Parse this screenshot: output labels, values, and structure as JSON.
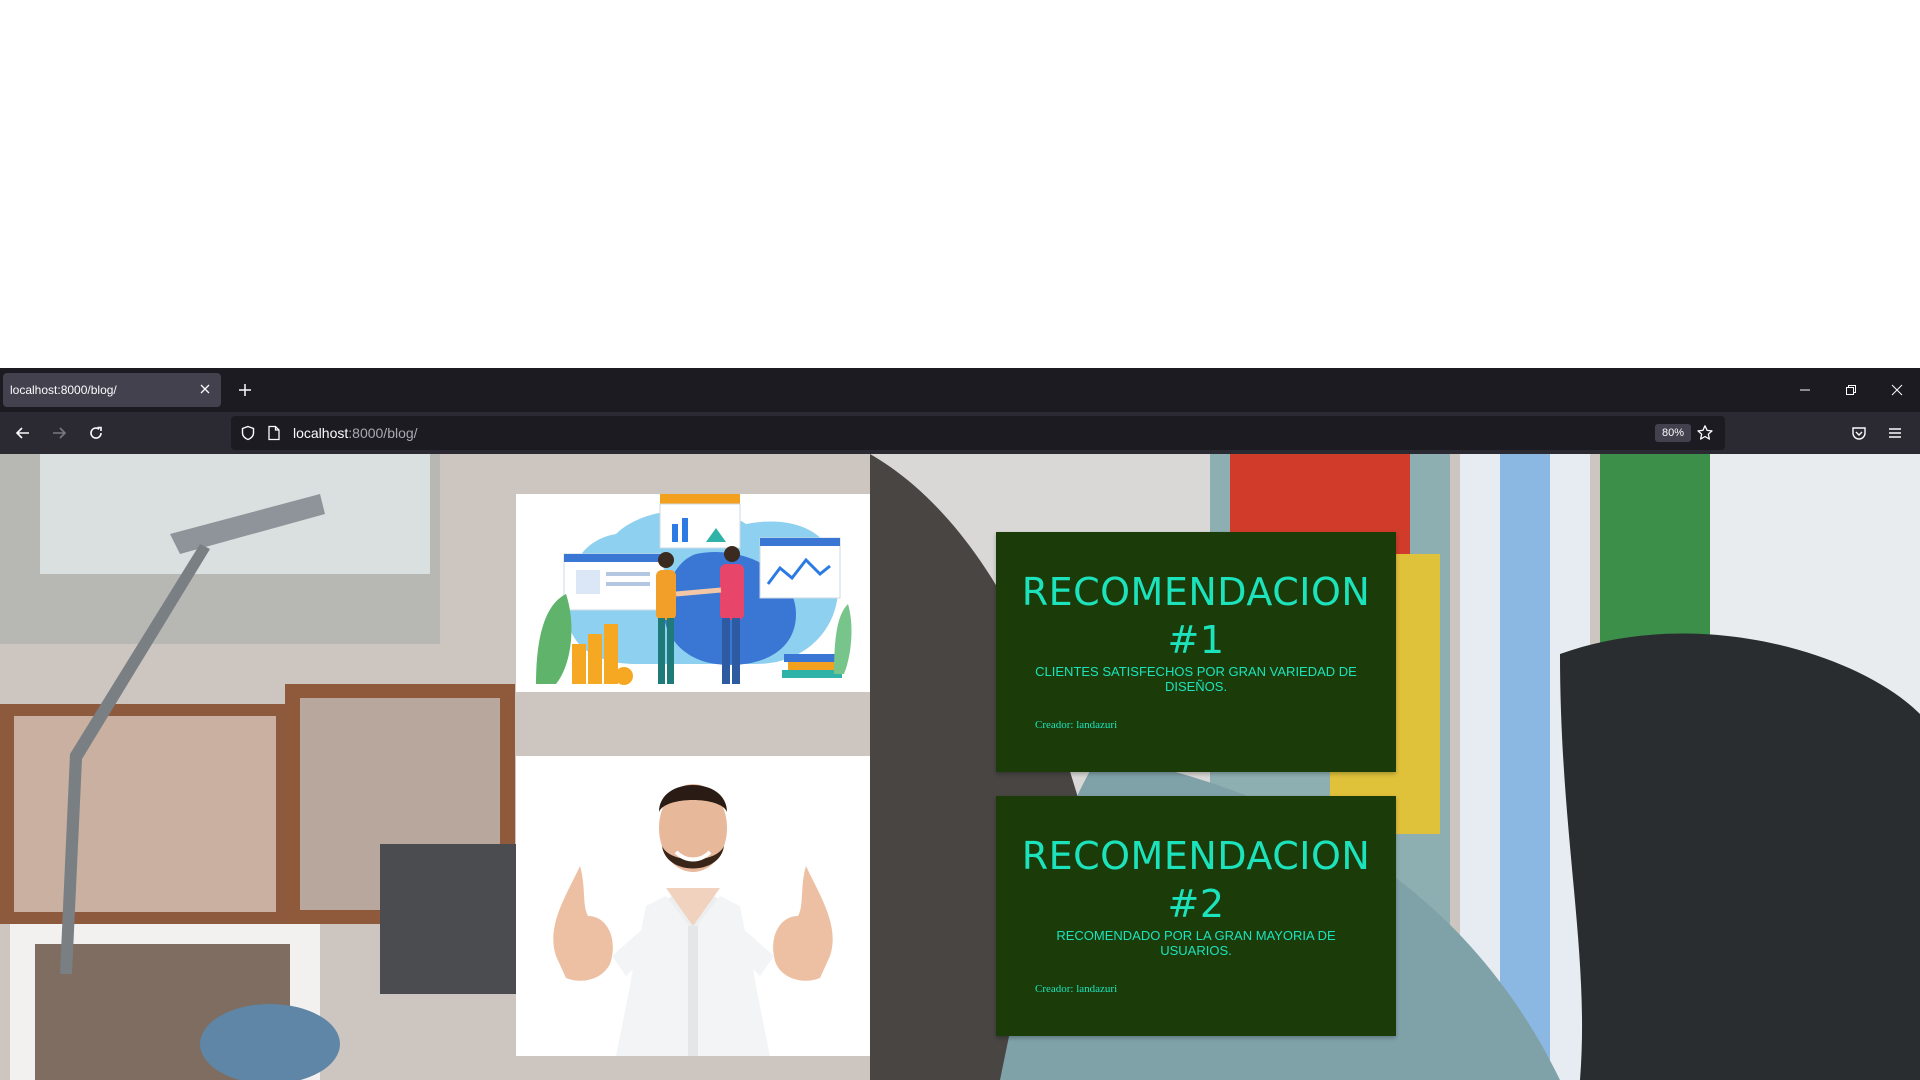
{
  "tab": {
    "title": "localhost:8000/blog/"
  },
  "urlbar": {
    "host": "localhost",
    "rest": ":8000/blog/",
    "zoom": "80%"
  },
  "recommendations": [
    {
      "title_line1": "RECOMENDACION",
      "title_line2": "#1",
      "description": "CLIENTES SATISFECHOS POR GRAN VARIEDAD DE DISEÑOS.",
      "author": "Creador: landazuri"
    },
    {
      "title_line1": "RECOMENDACION",
      "title_line2": "#2",
      "description": "RECOMENDADO POR LA GRAN MAYORIA DE USUARIOS.",
      "author": "Creador: landazuri"
    }
  ],
  "colors": {
    "card_bg": "#1b3c09",
    "card_text": "#1de3bd",
    "chrome_dark": "#1c1b22",
    "chrome_nav": "#2b2a33"
  }
}
